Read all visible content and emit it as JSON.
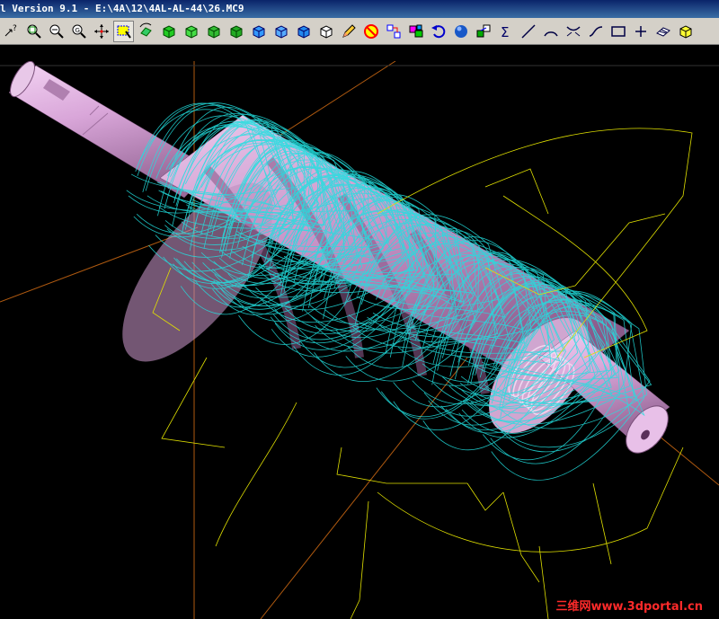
{
  "window": {
    "title": "l Version 9.1 - E:\\4A\\12\\4AL-AL-44\\26.MC9"
  },
  "toolbar": {
    "buttons": [
      {
        "icon": "help-arrow-icon"
      },
      {
        "icon": "zoom-window-icon"
      },
      {
        "icon": "zoom-out-icon"
      },
      {
        "icon": "zoom-fit-icon"
      },
      {
        "icon": "pan-icon"
      },
      {
        "icon": "select-window-icon"
      },
      {
        "icon": "dynamic-rotate-icon"
      },
      {
        "icon": "view-top-icon"
      },
      {
        "icon": "view-front-icon"
      },
      {
        "icon": "view-side-icon"
      },
      {
        "icon": "view-iso-icon"
      },
      {
        "icon": "cube-blue-1-icon"
      },
      {
        "icon": "cube-blue-2-icon"
      },
      {
        "icon": "cube-blue-3-icon"
      },
      {
        "icon": "cube-outline-icon"
      },
      {
        "icon": "pencil-icon"
      },
      {
        "icon": "no-circle-icon"
      },
      {
        "icon": "toolpath-icon"
      },
      {
        "icon": "group-icon"
      },
      {
        "icon": "undo-icon"
      },
      {
        "icon": "shade-sphere-icon"
      },
      {
        "icon": "transform-icon"
      },
      {
        "icon": "sigma-icon"
      },
      {
        "icon": "line-icon"
      },
      {
        "icon": "arc-icon"
      },
      {
        "icon": "fillet-icon"
      },
      {
        "icon": "spline-icon"
      },
      {
        "icon": "rectangle-icon"
      },
      {
        "icon": "point-plus-icon"
      },
      {
        "icon": "surface-icon"
      },
      {
        "icon": "solid-yellow-icon"
      }
    ]
  },
  "viewport": {
    "background": "#000000",
    "part_color": "#d9a6d9",
    "toolpath_color": "#22e0e0",
    "boundary_color": "#e0e000",
    "axis_color": "#b05a10"
  },
  "watermark": {
    "text": "三维网www.3dportal.cn"
  }
}
